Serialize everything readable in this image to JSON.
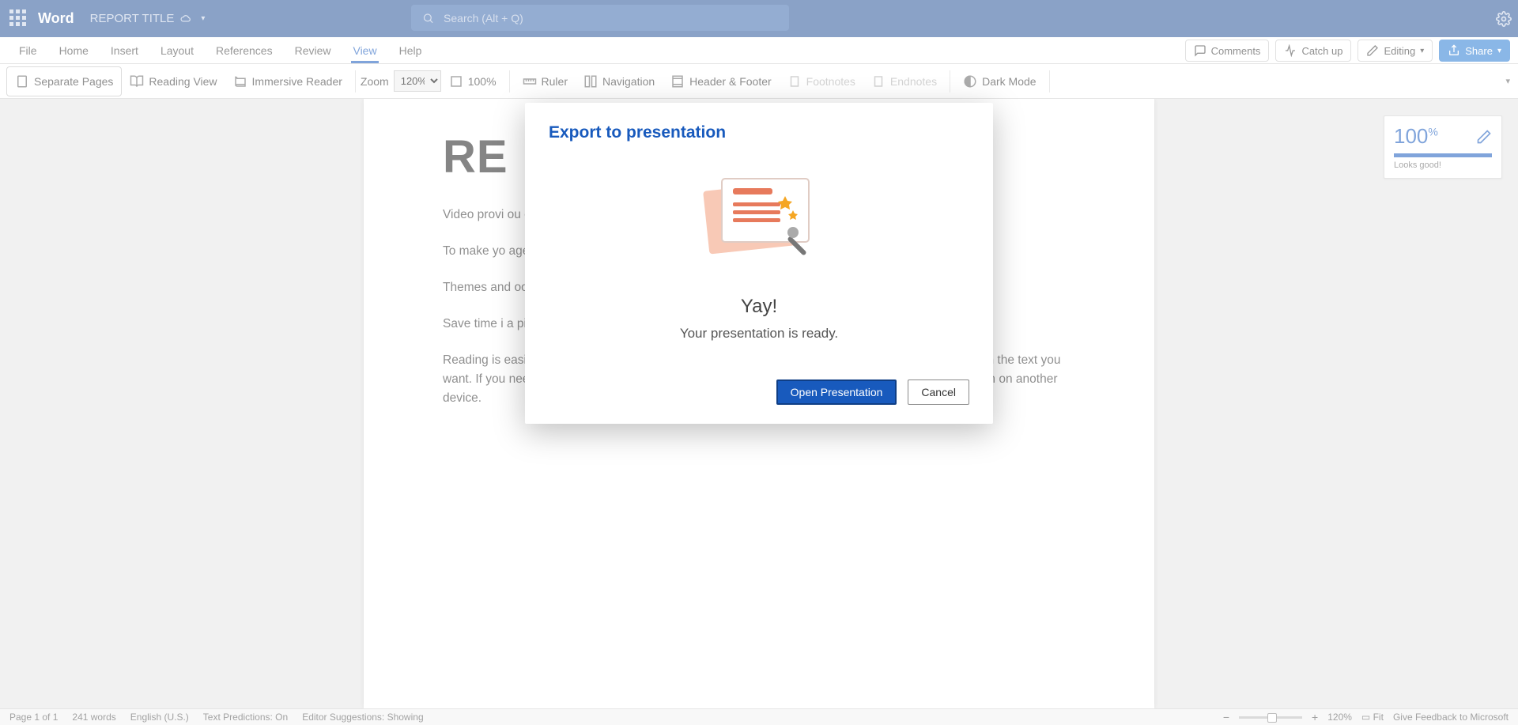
{
  "app": {
    "name": "Word",
    "doc_title": "REPORT TITLE"
  },
  "search": {
    "placeholder": "Search (Alt + Q)"
  },
  "tabs": {
    "items": [
      "File",
      "Home",
      "Insert",
      "Layout",
      "References",
      "Review",
      "View",
      "Help"
    ],
    "active": "View"
  },
  "topright": {
    "comments": "Comments",
    "catchup": "Catch up",
    "editing": "Editing",
    "share": "Share"
  },
  "ribbon": {
    "separate_pages": "Separate Pages",
    "reading_view": "Reading View",
    "immersive_reader": "Immersive Reader",
    "zoom_label": "Zoom",
    "zoom_value": "120%",
    "zoom_100": "100%",
    "ruler": "Ruler",
    "navigation": "Navigation",
    "header_footer": "Header & Footer",
    "footnotes": "Footnotes",
    "endnotes": "Endnotes",
    "dark_mode": "Dark Mode"
  },
  "document": {
    "heading": "RE",
    "p1": "Video provi                                                                                                                                                                ou can paste in the                                                                                                                                                               h online for the video th",
    "p2": "To make yo                                                                                                                                                               age, and text box des                                                                                                                                                                e, header, and sidebar",
    "p3": "Themes and                                                                                                                                                               oose a new Theme, the                                                                                                                                                                you apply styles, your",
    "p4": "Save time i                                                                                                                                                                a picture fits in your c                                                                                                                                                               ork on a table, click w",
    "p5": "Reading is easier, too, in the new Reading view. You can collapse parts of the document and focus on the text you want. If you need to stop reading before you reach the end, Word remembers where you left off - even on another device."
  },
  "score": {
    "value": "100",
    "pct": "%",
    "text": "Looks good!"
  },
  "modal": {
    "title": "Export to presentation",
    "yay": "Yay!",
    "sub": "Your presentation is ready.",
    "open": "Open Presentation",
    "cancel": "Cancel"
  },
  "status": {
    "page": "Page 1 of 1",
    "words": "241 words",
    "lang": "English (U.S.)",
    "predictions": "Text Predictions: On",
    "suggestions": "Editor Suggestions: Showing",
    "zoom": "120%",
    "fit": "Fit",
    "feedback": "Give Feedback to Microsoft"
  }
}
